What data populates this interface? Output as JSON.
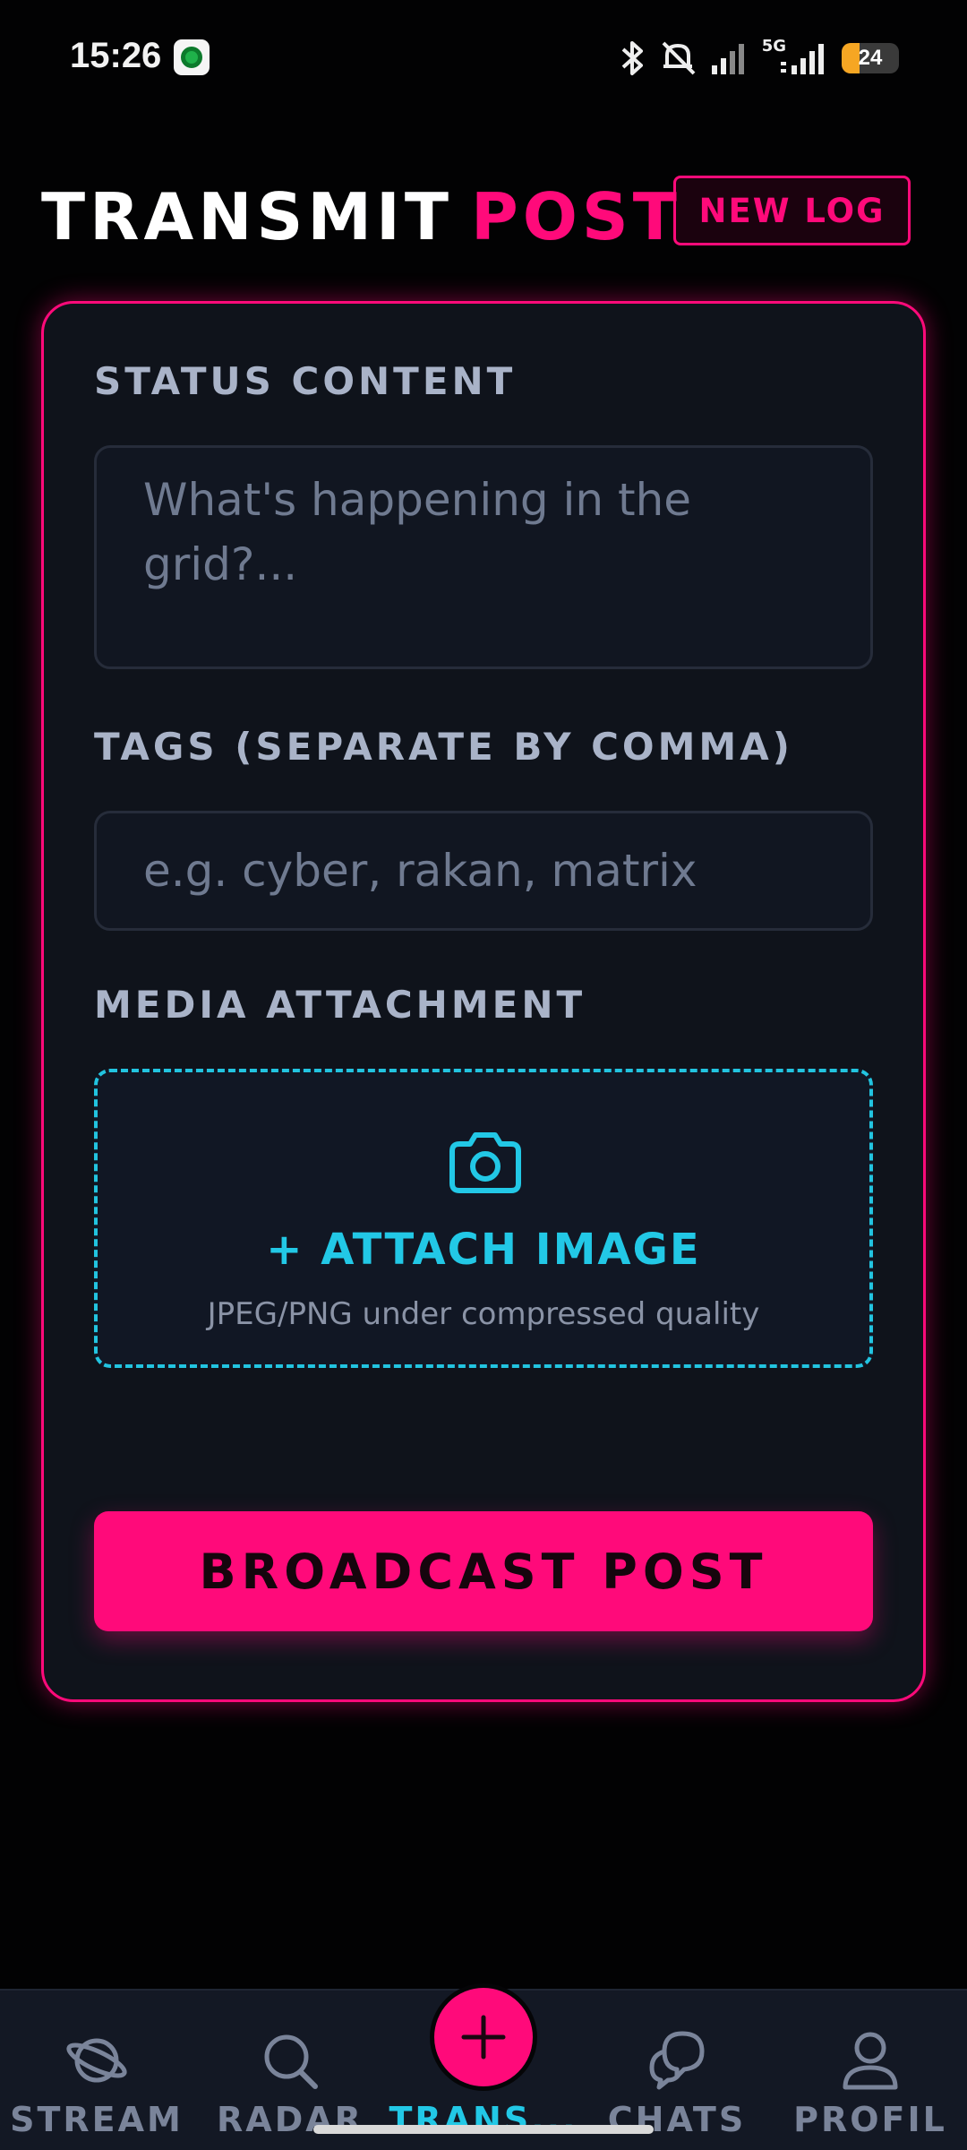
{
  "status_bar": {
    "time": "15:26",
    "network": "5G",
    "battery": "24"
  },
  "header": {
    "title_part1": "TRANSMIT",
    "title_part2": "POST",
    "new_log_label": "NEW LOG"
  },
  "form": {
    "status": {
      "label": "STATUS CONTENT",
      "placeholder": "What's happening in the grid?..."
    },
    "tags": {
      "label": "TAGS (SEPARATE BY COMMA)",
      "placeholder": "e.g. cyber, rakan, matrix"
    },
    "media": {
      "label": "MEDIA ATTACHMENT",
      "icon": "camera-icon",
      "attach_label": "+ ATTACH IMAGE",
      "hint": "JPEG/PNG under compressed quality"
    },
    "submit_label": "BROADCAST POST"
  },
  "nav": {
    "items": [
      {
        "label": "STREAM",
        "icon": "planet-icon"
      },
      {
        "label": "RADAR",
        "icon": "search-icon"
      },
      {
        "label": "TRANS...",
        "icon": "plus-icon",
        "active": true
      },
      {
        "label": "CHATS",
        "icon": "chat-bubbles-icon"
      },
      {
        "label": "PROFIL",
        "icon": "user-icon"
      }
    ]
  },
  "colors": {
    "accent_pink": "#ff0a7a",
    "accent_cyan": "#22c8e6",
    "background": "#020203",
    "card": "#0f131b"
  }
}
